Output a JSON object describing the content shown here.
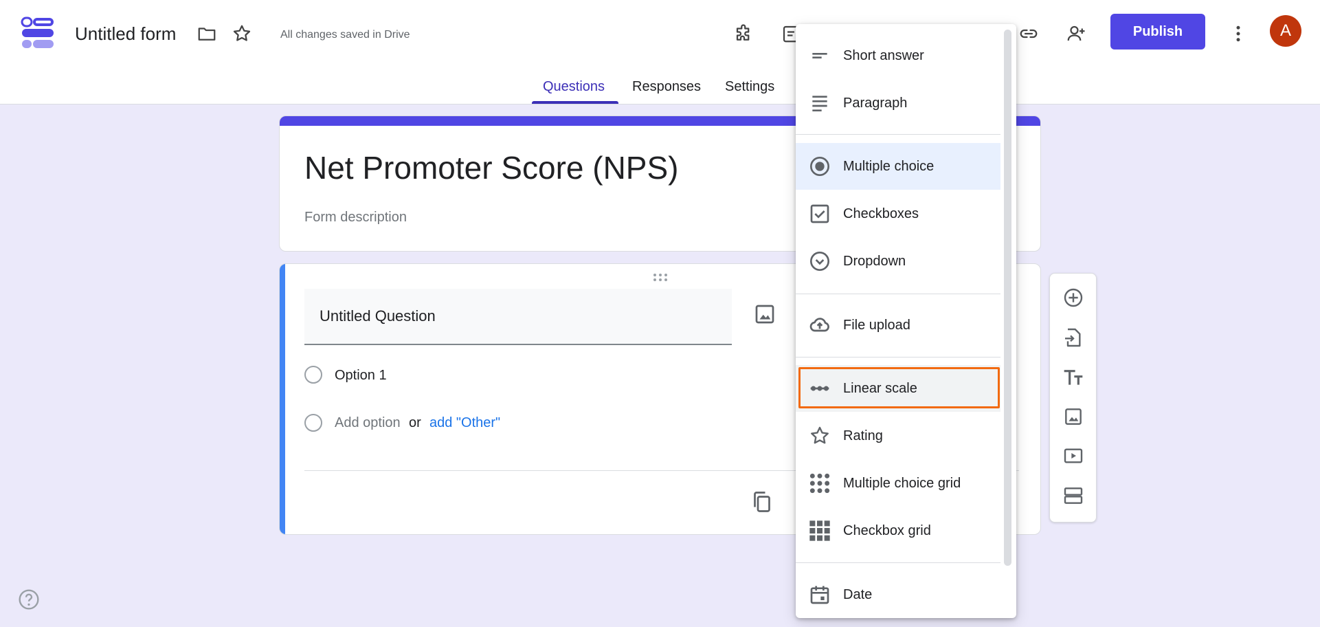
{
  "header": {
    "form_title": "Untitled form",
    "saved_status": "All changes saved in Drive",
    "publish_label": "Publish",
    "avatar_initial": "A"
  },
  "tabs": [
    {
      "label": "Questions",
      "active": true
    },
    {
      "label": "Responses",
      "active": false
    },
    {
      "label": "Settings",
      "active": false
    }
  ],
  "form": {
    "title": "Net Promoter Score (NPS)",
    "description_placeholder": "Form description"
  },
  "question": {
    "title": "Untitled Question",
    "options": [
      "Option 1"
    ],
    "add_option_label": "Add option",
    "or_label": "or",
    "add_other_label": "add \"Other\""
  },
  "question_type_menu": {
    "items": [
      {
        "label": "Short answer",
        "icon": "short-answer-icon"
      },
      {
        "label": "Paragraph",
        "icon": "paragraph-icon"
      },
      {
        "label": "Multiple choice",
        "icon": "radio-button-icon",
        "state": "hovered"
      },
      {
        "label": "Checkboxes",
        "icon": "checkbox-icon"
      },
      {
        "label": "Dropdown",
        "icon": "dropdown-circle-icon"
      },
      {
        "label": "File upload",
        "icon": "cloud-upload-icon"
      },
      {
        "label": "Linear scale",
        "icon": "linear-scale-icon",
        "state": "highlighted"
      },
      {
        "label": "Rating",
        "icon": "star-outline-icon"
      },
      {
        "label": "Multiple choice grid",
        "icon": "dot-grid-icon"
      },
      {
        "label": "Checkbox grid",
        "icon": "square-grid-icon"
      },
      {
        "label": "Date",
        "icon": "calendar-icon"
      }
    ]
  },
  "colors": {
    "brand": "#5046e4",
    "accent_blue": "#4285f4",
    "highlight_outline": "#f26a10",
    "avatar": "#c0360c",
    "page_background": "#ebe9fa"
  }
}
